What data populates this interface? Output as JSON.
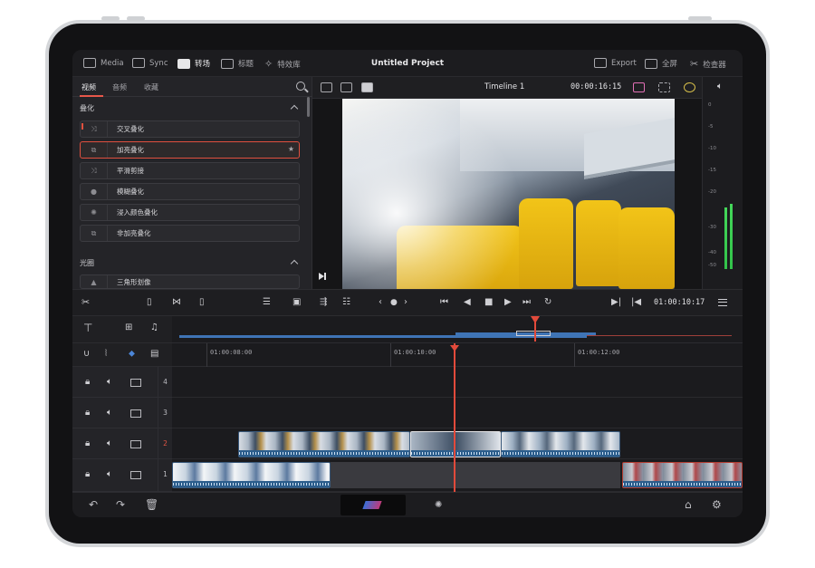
{
  "topbar": {
    "items": [
      {
        "label": "Media",
        "icon": "media-icon"
      },
      {
        "label": "Sync",
        "icon": "sync-icon"
      },
      {
        "label": "转场",
        "icon": "transition-icon",
        "active": true
      },
      {
        "label": "标题",
        "icon": "title-icon"
      },
      {
        "label": "特效库",
        "icon": "effects-wand-icon"
      }
    ],
    "project_title": "Untitled Project",
    "right_items": [
      {
        "label": "Export",
        "icon": "export-icon"
      },
      {
        "label": "全屏",
        "icon": "fullscreen-icon"
      },
      {
        "label": "检查器",
        "icon": "inspector-icon"
      }
    ]
  },
  "effects_panel": {
    "tabs": [
      "视频",
      "音频",
      "收藏"
    ],
    "active_tab": "视频",
    "sections": [
      {
        "title": "叠化",
        "items": [
          {
            "label": "交叉叠化",
            "icon": "crossfade-icon"
          },
          {
            "label": "加亮叠化",
            "icon": "additive-dissolve-icon",
            "selected": true,
            "favorite": "★"
          },
          {
            "label": "平滑剪接",
            "icon": "smooth-cut-icon"
          },
          {
            "label": "模糊叠化",
            "icon": "blur-drop-icon"
          },
          {
            "label": "浸入颜色叠化",
            "icon": "dip-color-icon"
          },
          {
            "label": "非加亮叠化",
            "icon": "non-additive-icon"
          }
        ]
      },
      {
        "title": "光圈",
        "items": [
          {
            "label": "三角形划像",
            "icon": "triangle-iris-icon"
          }
        ]
      }
    ]
  },
  "viewer": {
    "timeline_name": "Timeline 1",
    "source_timecode": "00:00:16:15"
  },
  "meter": {
    "scale": [
      "0",
      "-5",
      "-10",
      "-15",
      "-20",
      "-30",
      "-40",
      "-50"
    ],
    "levels": [
      0.36,
      0.38
    ]
  },
  "transport": {
    "timecode": "01:00:10:17"
  },
  "timeline": {
    "ruler": [
      "01:00:08:00",
      "01:00:10:00",
      "01:00:12:00"
    ],
    "tracks": [
      {
        "number": "4"
      },
      {
        "number": "3"
      },
      {
        "number": "2",
        "active": true
      },
      {
        "number": "1"
      }
    ]
  },
  "colors": {
    "accent": "#e24a3b",
    "meter_green": "#3ccf52",
    "clip_blue": "#6f93b8"
  }
}
